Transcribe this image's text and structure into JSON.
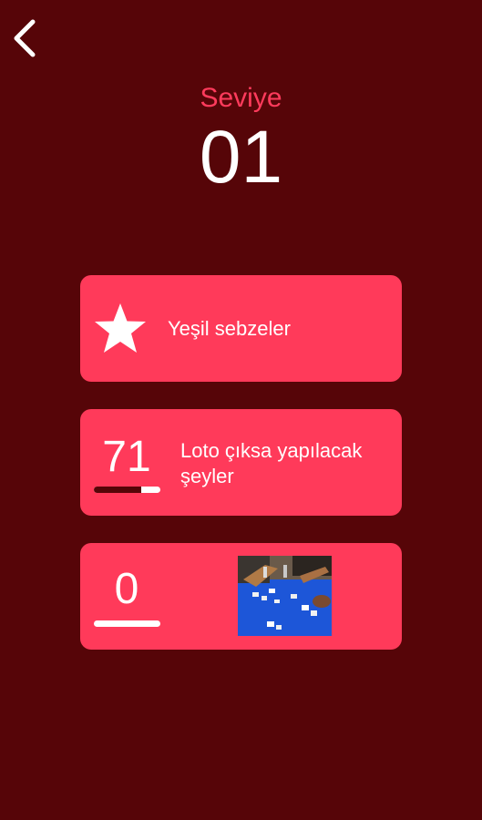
{
  "colors": {
    "background": "#560508",
    "card": "#ff3a5a",
    "accent_text": "#ff3b5c",
    "text": "#ffffff"
  },
  "header": {
    "back_icon": "chevron-left-icon",
    "level_label": "Seviye",
    "level_number": "01"
  },
  "cards": [
    {
      "icon": "star-icon",
      "text": "Yeşil sebzeler"
    },
    {
      "count": "71",
      "progress_fraction": 0.71,
      "text": "Loto çıksa yapılacak şeyler"
    },
    {
      "count": "0",
      "progress_fraction": 0,
      "image": "photo of people playing okey/rummikub tiles on a blue table"
    }
  ]
}
